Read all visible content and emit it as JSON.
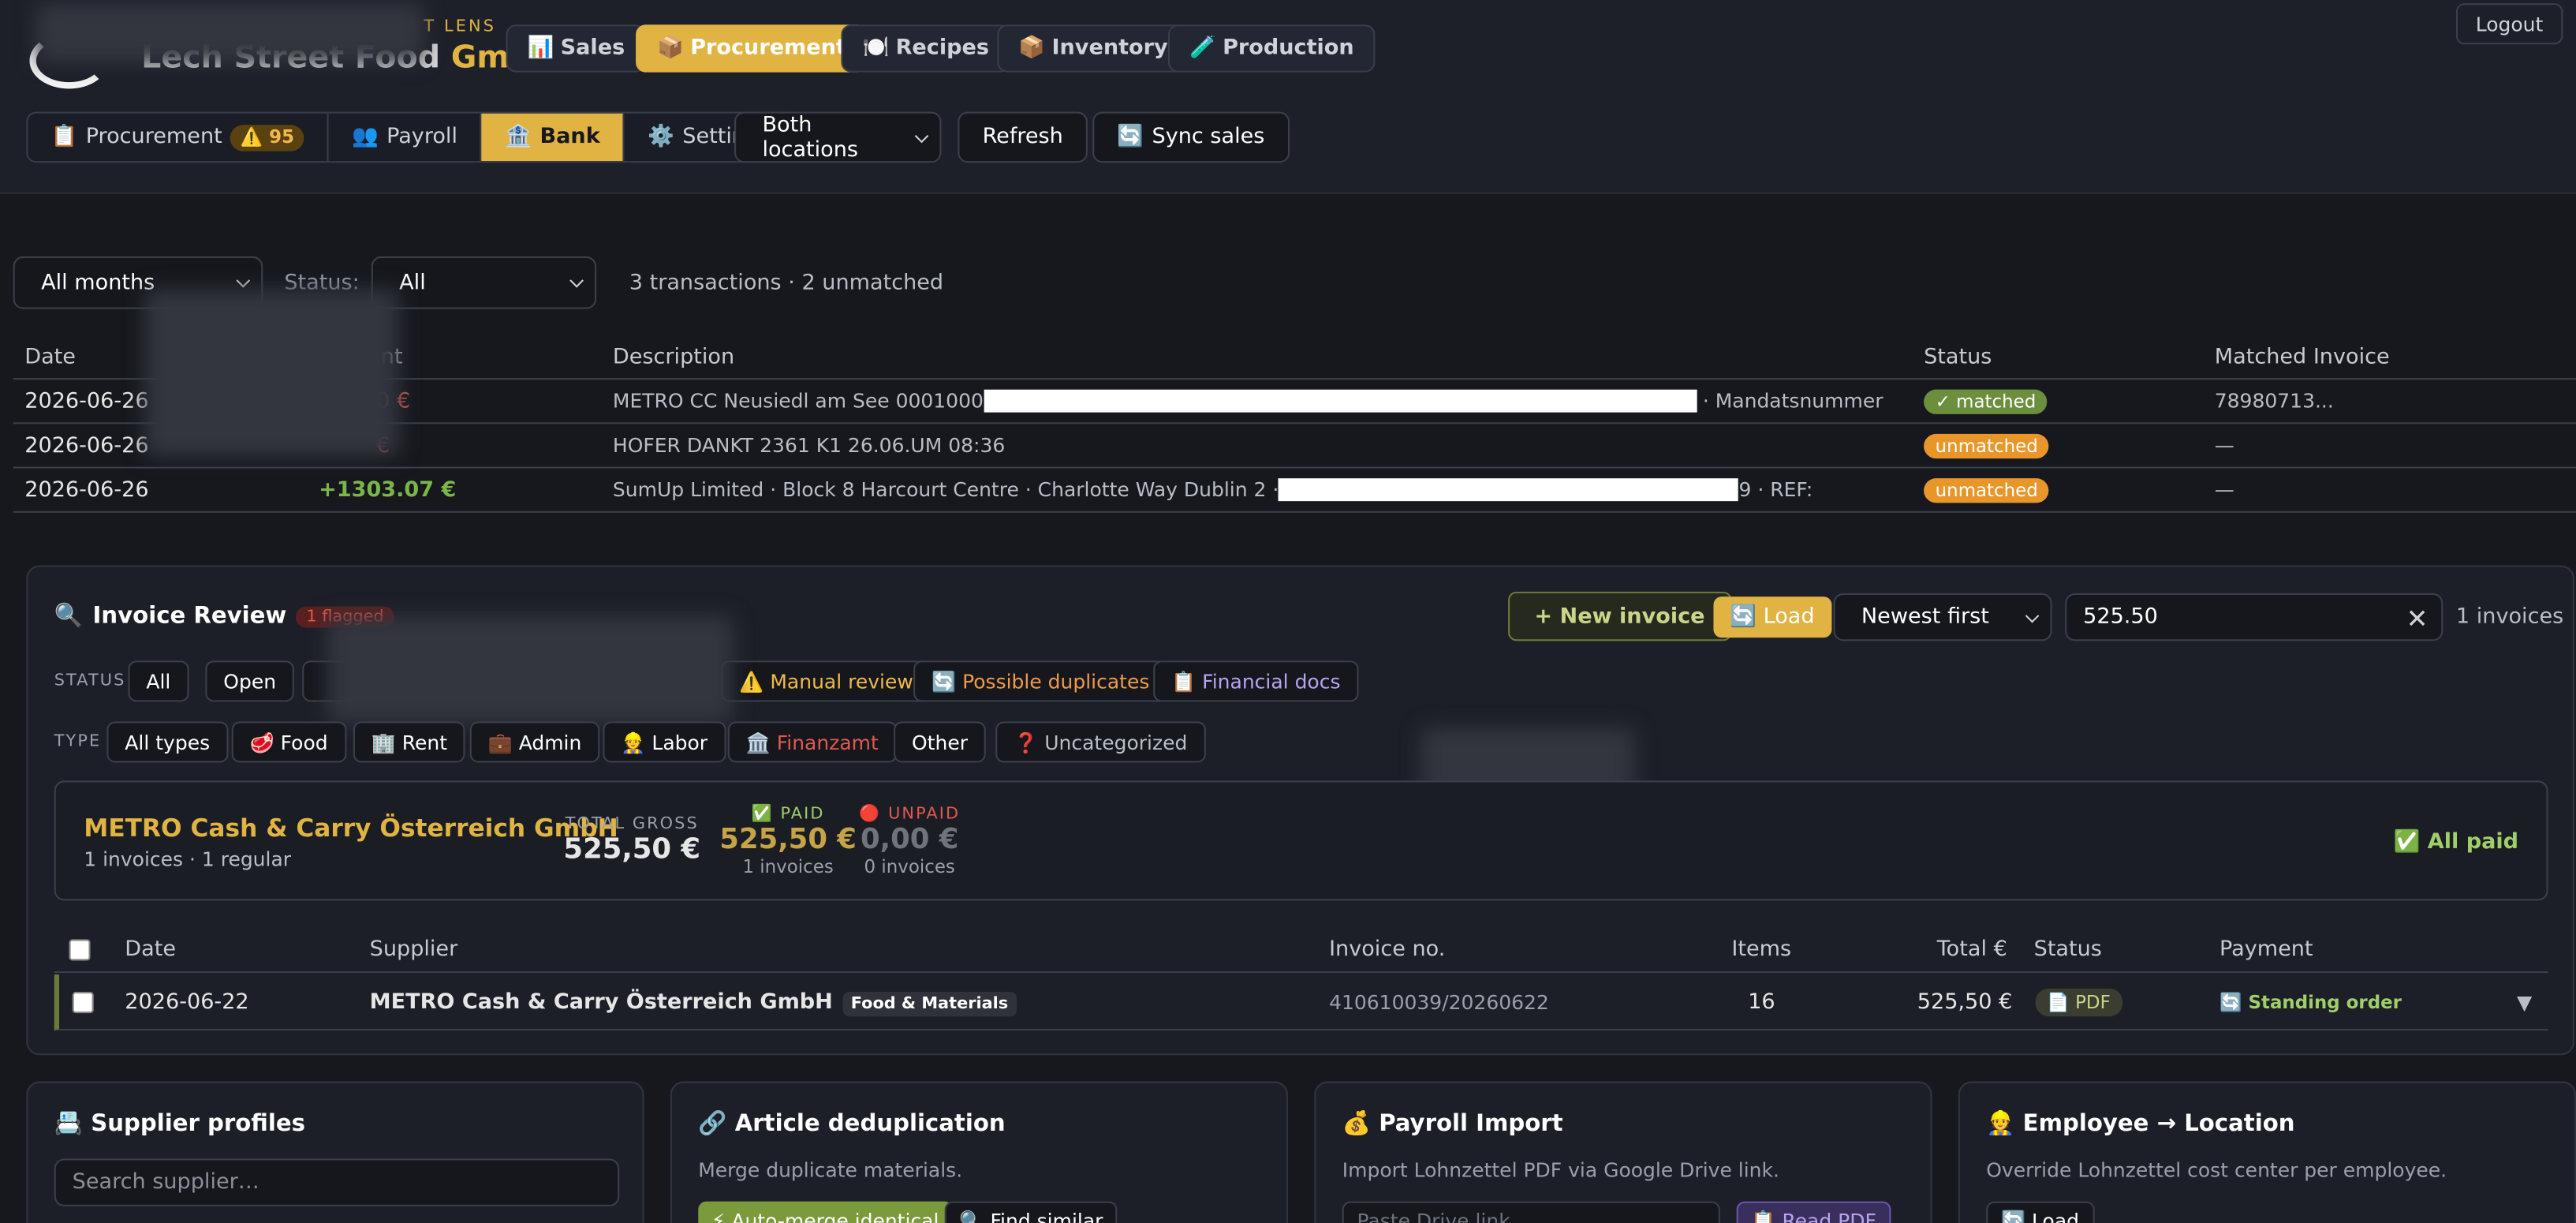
{
  "app": {
    "brand_main": "Lech Street Food ",
    "brand_accent": "GmbH",
    "brand_small": "T LENS",
    "logout": "Logout"
  },
  "nav": [
    {
      "icon": "📊",
      "label": "Sales"
    },
    {
      "icon": "📦",
      "label": "Procurement"
    },
    {
      "icon": "🍽️",
      "label": "Recipes"
    },
    {
      "icon": "📦",
      "label": "Inventory"
    },
    {
      "icon": "🧪",
      "label": "Production"
    }
  ],
  "subtabs": [
    {
      "icon": "📋",
      "label": "Procurement",
      "badge": "⚠️ 95"
    },
    {
      "icon": "👥",
      "label": "Payroll"
    },
    {
      "icon": "🏦",
      "label": "Bank"
    },
    {
      "icon": "⚙️",
      "label": "Settings"
    }
  ],
  "toolbar": {
    "location": "Both locations",
    "refresh": "Refresh",
    "sync_icon": "🔄",
    "sync": "Sync sales"
  },
  "bank": {
    "month_filter": "All months",
    "status_label": "Status:",
    "status_filter": "All",
    "summary": "3 transactions · 2 unmatched",
    "columns": [
      "Date",
      "Amount",
      "Description",
      "Status",
      "Matched Invoice"
    ],
    "rows": [
      {
        "date": "2026-06-26",
        "amount": "0 €",
        "desc_a": "METRO CC Neusiedl am See 0001000",
        "desc_b": " · Mandatsnummer",
        "status": "✓ matched",
        "match": "78980713..."
      },
      {
        "date": "2026-06-26",
        "amount": "€",
        "desc_a": "HOFER DANKT 2361 K1 26.06.UM 08:36",
        "desc_b": "",
        "status": "unmatched",
        "match": "—"
      },
      {
        "date": "2026-06-26",
        "amount": "+1303.07 €",
        "desc_a": "SumUp Limited · Block 8 Harcourt Centre · Charlotte Way Dublin 2 ·",
        "desc_b": "9 · REF:",
        "status": "unmatched",
        "match": "—"
      }
    ]
  },
  "review": {
    "title_icon": "🔍",
    "title": "Invoice Review",
    "flag_badge": "1 flagged",
    "new_invoice": "+ New invoice",
    "load": "🔄 Load",
    "sort": "Newest first",
    "search_value": "525.50",
    "count": "1 invoices",
    "status_label": "STATUS",
    "status_chips": [
      "All",
      "Open",
      "⚠️ Manual review",
      "🔄 Possible duplicates",
      "📋 Financial docs"
    ],
    "type_label": "TYPE",
    "type_chips": [
      "All types",
      "🥩 Food",
      "🏢 Rent",
      "💼 Admin",
      "👷 Labor",
      "🏛️ Finanzamt",
      "Other",
      "❓ Uncategorized"
    ],
    "summary": {
      "supplier": "METRO Cash & Carry Österreich GmbH",
      "sub": "1 invoices · 1 regular",
      "total_label": "TOTAL GROSS",
      "total": "525,50 €",
      "paid_label": "✅ PAID",
      "paid": "525,50 €",
      "paid_sub": "1 invoices",
      "unpaid_label": "🔴 UNPAID",
      "unpaid": "0,00 €",
      "unpaid_sub": "0 invoices",
      "all_paid": "✅ All paid"
    },
    "columns": [
      "Date",
      "Supplier",
      "Invoice no.",
      "Items",
      "Total €",
      "Status",
      "Payment"
    ],
    "row": {
      "date": "2026-06-22",
      "supplier": "METRO Cash & Carry Österreich GmbH",
      "tag": "Food & Materials",
      "invoice_no": "410610039/20260622",
      "items": "16",
      "total": "525,50 €",
      "status": "📄 PDF",
      "payment": "🔄 Standing order",
      "expand": "▼"
    }
  },
  "cards": [
    {
      "title": "📇 Supplier profiles",
      "placeholder": "Search supplier…"
    },
    {
      "title": "🔗 Article deduplication",
      "sub": "Merge duplicate materials.",
      "btn1": "⚡ Auto-merge identical",
      "btn2": "🔍 Find similar"
    },
    {
      "title": "💰 Payroll Import",
      "sub": "Import Lohnzettel PDF via Google Drive link.",
      "placeholder": "Paste Drive link",
      "btn": "📋 Read PDF"
    },
    {
      "title": "👷 Employee → Location",
      "sub": "Override Lohnzettel cost center per employee.",
      "btn": "🔄 Load"
    }
  ],
  "colors": {
    "accent": "#e0b343",
    "matched": "#6b8f3c",
    "unmatched": "#e8962a",
    "negative": "#e05a4e",
    "positive": "#7ab648"
  }
}
